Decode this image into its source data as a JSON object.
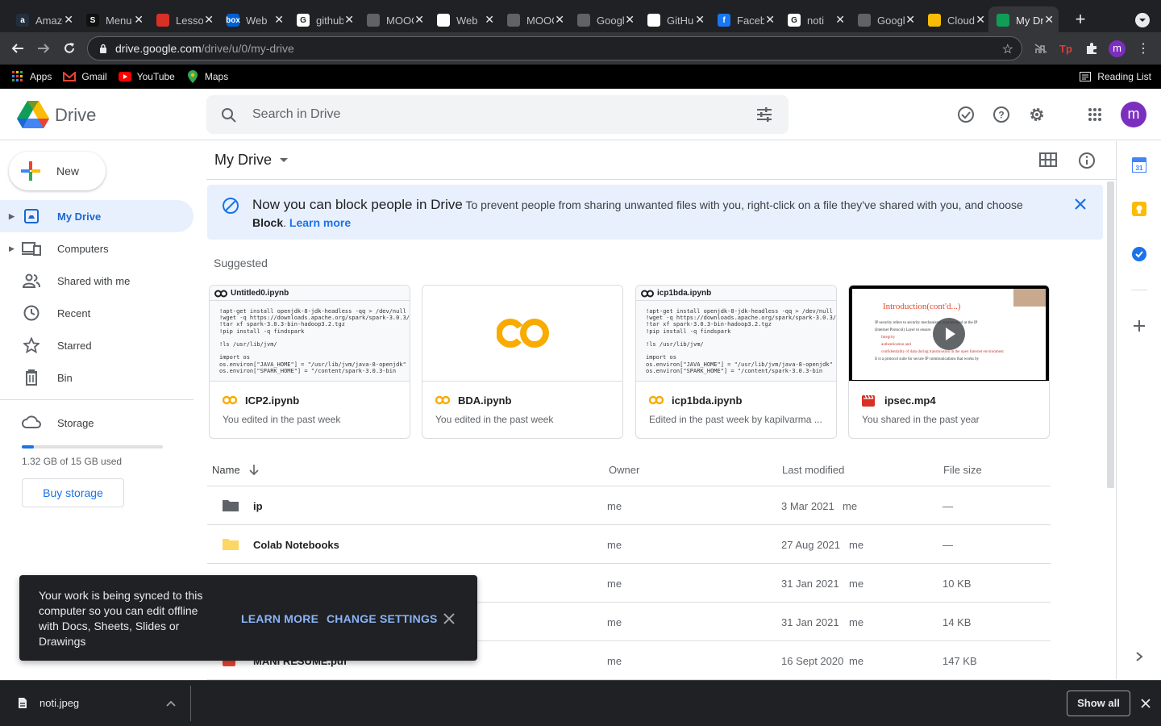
{
  "browser": {
    "tabs": [
      {
        "title": "Amazon",
        "fav": "a",
        "color": "#232f3e"
      },
      {
        "title": "Menu",
        "fav": "S",
        "color": "#111111"
      },
      {
        "title": "Lesson",
        "fav": "",
        "color": "#d93025"
      },
      {
        "title": "Web",
        "fav": "box",
        "color": "#0061d5"
      },
      {
        "title": "github",
        "fav": "G",
        "color": "#ffffff"
      },
      {
        "title": "MOOC",
        "fav": "",
        "color": "#5f6368"
      },
      {
        "title": "Web",
        "fav": "",
        "color": "#ffffff"
      },
      {
        "title": "MOOC",
        "fav": "",
        "color": "#5f6368"
      },
      {
        "title": "Google",
        "fav": "",
        "color": "#5f6368"
      },
      {
        "title": "GitHub",
        "fav": "",
        "color": "#ffffff"
      },
      {
        "title": "Facebook",
        "fav": "f",
        "color": "#1877f2"
      },
      {
        "title": "noti",
        "fav": "G",
        "color": "#ffffff"
      },
      {
        "title": "Google",
        "fav": "",
        "color": "#5f6368"
      },
      {
        "title": "Cloud",
        "fav": "",
        "color": "#fbbc04"
      },
      {
        "title": "My Drive",
        "fav": "",
        "color": "#0f9d58"
      }
    ],
    "url_host": "drive.google.com",
    "url_path": "/drive/u/0/my-drive",
    "profile_initial": "m",
    "bookmarks": [
      "Apps",
      "Gmail",
      "YouTube",
      "Maps"
    ],
    "reading_list": "Reading List"
  },
  "header": {
    "logo_text": "Drive",
    "search_placeholder": "Search in Drive",
    "avatar_initial": "m"
  },
  "sidebar": {
    "new_label": "New",
    "items": [
      {
        "label": "My Drive"
      },
      {
        "label": "Computers"
      },
      {
        "label": "Shared with me"
      },
      {
        "label": "Recent"
      },
      {
        "label": "Starred"
      },
      {
        "label": "Bin"
      }
    ],
    "storage_label": "Storage",
    "storage_used": "1.32 GB of 15 GB used",
    "storage_fraction": 0.088,
    "buy_storage": "Buy storage"
  },
  "main": {
    "title": "My Drive",
    "banner": {
      "headline": "Now you can block people in Drive",
      "body": "To prevent people from sharing unwanted files with you, right-click on a file they've shared with you, and choose",
      "bold": "Block",
      "link": "Learn more"
    },
    "suggested_label": "Suggested",
    "cards": [
      {
        "name": "ICP2.ipynb",
        "sub": "You edited in the past week",
        "preview_title": "Untitled0.ipynb",
        "type": "colab"
      },
      {
        "name": "BDA.ipynb",
        "sub": "You edited in the past week",
        "preview_title": "",
        "type": "colab-logo"
      },
      {
        "name": "icp1bda.ipynb",
        "sub": "Edited in the past week by kapilvarma ...",
        "preview_title": "icp1bda.ipynb",
        "type": "colab"
      },
      {
        "name": "ipsec.mp4",
        "sub": "You shared in the past year",
        "preview_title": "Introduction(cont'd...)",
        "type": "video"
      }
    ],
    "code_preview": "!apt-get install openjdk-8-jdk-headless -qq > /dev/null\n!wget -q https://downloads.apache.org/spark/spark-3.0.3/\n!tar xf spark-3.0.3-bin-hadoop3.2.tgz\n!pip install -q findspark\n\n!ls /usr/lib/jvm/\n\nimport os\nos.environ[\"JAVA_HOME\"] = \"/usr/lib/jvm/java-8-openjdk\"\nos.environ[\"SPARK_HOME\"] = \"/content/spark-3.0.3-bin",
    "video_lines": [
      "IP security refers to security mechanisms implemented at the IP",
      "(Internet Protocol) Layer to ensure",
      "Integrity",
      "authentication and",
      "confidentiality of data during transmission in the open Internet environment",
      "It is a protocol suite for secure IP communications that works by"
    ],
    "columns": {
      "name": "Name",
      "owner": "Owner",
      "modified": "Last modified",
      "size": "File size"
    },
    "rows": [
      {
        "name": "ip",
        "owner": "me",
        "date": "3 Mar 2021",
        "by": "me",
        "size": "—",
        "kind": "folder-dark"
      },
      {
        "name": "Colab Notebooks",
        "owner": "me",
        "date": "27 Aug 2021",
        "by": "me",
        "size": "—",
        "kind": "folder-yellow"
      },
      {
        "name": "",
        "owner": "me",
        "date": "31 Jan 2021",
        "by": "me",
        "size": "10 KB",
        "kind": "hidden"
      },
      {
        "name": "",
        "owner": "me",
        "date": "31 Jan 2021",
        "by": "me",
        "size": "14 KB",
        "kind": "hidden"
      },
      {
        "name": "MANI RESUME.pdf",
        "owner": "me",
        "date": "16 Sept 2020",
        "by": "me",
        "size": "147 KB",
        "kind": "pdf"
      }
    ]
  },
  "toast": {
    "message": "Your work is being synced to this computer so you can edit offline with Docs, Sheets, Slides or Drawings",
    "learn_more": "LEARN MORE",
    "change_settings": "CHANGE SETTINGS"
  },
  "downloads": {
    "file": "noti.jpeg",
    "show_all": "Show all"
  }
}
